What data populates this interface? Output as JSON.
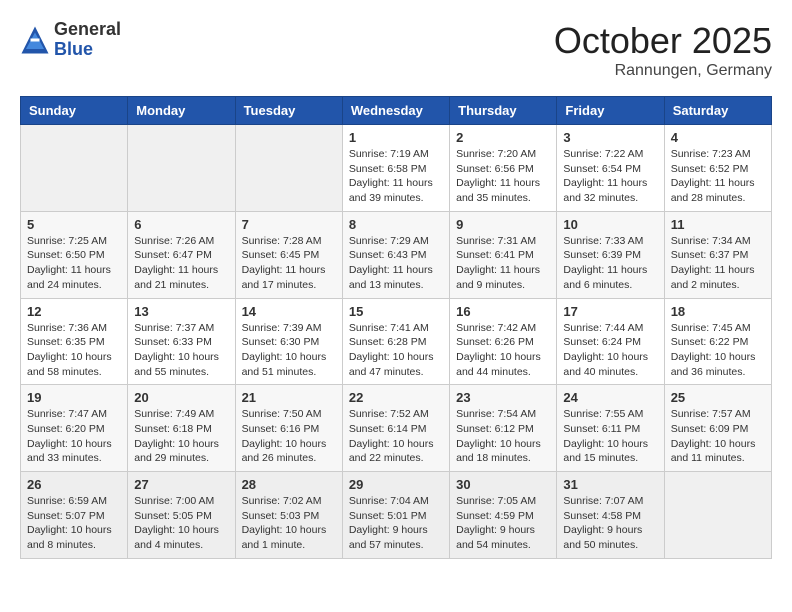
{
  "header": {
    "logo_general": "General",
    "logo_blue": "Blue",
    "month": "October 2025",
    "location": "Rannungen, Germany"
  },
  "weekdays": [
    "Sunday",
    "Monday",
    "Tuesday",
    "Wednesday",
    "Thursday",
    "Friday",
    "Saturday"
  ],
  "weeks": [
    [
      {
        "day": "",
        "info": ""
      },
      {
        "day": "",
        "info": ""
      },
      {
        "day": "",
        "info": ""
      },
      {
        "day": "1",
        "info": "Sunrise: 7:19 AM\nSunset: 6:58 PM\nDaylight: 11 hours and 39 minutes."
      },
      {
        "day": "2",
        "info": "Sunrise: 7:20 AM\nSunset: 6:56 PM\nDaylight: 11 hours and 35 minutes."
      },
      {
        "day": "3",
        "info": "Sunrise: 7:22 AM\nSunset: 6:54 PM\nDaylight: 11 hours and 32 minutes."
      },
      {
        "day": "4",
        "info": "Sunrise: 7:23 AM\nSunset: 6:52 PM\nDaylight: 11 hours and 28 minutes."
      }
    ],
    [
      {
        "day": "5",
        "info": "Sunrise: 7:25 AM\nSunset: 6:50 PM\nDaylight: 11 hours and 24 minutes."
      },
      {
        "day": "6",
        "info": "Sunrise: 7:26 AM\nSunset: 6:47 PM\nDaylight: 11 hours and 21 minutes."
      },
      {
        "day": "7",
        "info": "Sunrise: 7:28 AM\nSunset: 6:45 PM\nDaylight: 11 hours and 17 minutes."
      },
      {
        "day": "8",
        "info": "Sunrise: 7:29 AM\nSunset: 6:43 PM\nDaylight: 11 hours and 13 minutes."
      },
      {
        "day": "9",
        "info": "Sunrise: 7:31 AM\nSunset: 6:41 PM\nDaylight: 11 hours and 9 minutes."
      },
      {
        "day": "10",
        "info": "Sunrise: 7:33 AM\nSunset: 6:39 PM\nDaylight: 11 hours and 6 minutes."
      },
      {
        "day": "11",
        "info": "Sunrise: 7:34 AM\nSunset: 6:37 PM\nDaylight: 11 hours and 2 minutes."
      }
    ],
    [
      {
        "day": "12",
        "info": "Sunrise: 7:36 AM\nSunset: 6:35 PM\nDaylight: 10 hours and 58 minutes."
      },
      {
        "day": "13",
        "info": "Sunrise: 7:37 AM\nSunset: 6:33 PM\nDaylight: 10 hours and 55 minutes."
      },
      {
        "day": "14",
        "info": "Sunrise: 7:39 AM\nSunset: 6:30 PM\nDaylight: 10 hours and 51 minutes."
      },
      {
        "day": "15",
        "info": "Sunrise: 7:41 AM\nSunset: 6:28 PM\nDaylight: 10 hours and 47 minutes."
      },
      {
        "day": "16",
        "info": "Sunrise: 7:42 AM\nSunset: 6:26 PM\nDaylight: 10 hours and 44 minutes."
      },
      {
        "day": "17",
        "info": "Sunrise: 7:44 AM\nSunset: 6:24 PM\nDaylight: 10 hours and 40 minutes."
      },
      {
        "day": "18",
        "info": "Sunrise: 7:45 AM\nSunset: 6:22 PM\nDaylight: 10 hours and 36 minutes."
      }
    ],
    [
      {
        "day": "19",
        "info": "Sunrise: 7:47 AM\nSunset: 6:20 PM\nDaylight: 10 hours and 33 minutes."
      },
      {
        "day": "20",
        "info": "Sunrise: 7:49 AM\nSunset: 6:18 PM\nDaylight: 10 hours and 29 minutes."
      },
      {
        "day": "21",
        "info": "Sunrise: 7:50 AM\nSunset: 6:16 PM\nDaylight: 10 hours and 26 minutes."
      },
      {
        "day": "22",
        "info": "Sunrise: 7:52 AM\nSunset: 6:14 PM\nDaylight: 10 hours and 22 minutes."
      },
      {
        "day": "23",
        "info": "Sunrise: 7:54 AM\nSunset: 6:12 PM\nDaylight: 10 hours and 18 minutes."
      },
      {
        "day": "24",
        "info": "Sunrise: 7:55 AM\nSunset: 6:11 PM\nDaylight: 10 hours and 15 minutes."
      },
      {
        "day": "25",
        "info": "Sunrise: 7:57 AM\nSunset: 6:09 PM\nDaylight: 10 hours and 11 minutes."
      }
    ],
    [
      {
        "day": "26",
        "info": "Sunrise: 6:59 AM\nSunset: 5:07 PM\nDaylight: 10 hours and 8 minutes."
      },
      {
        "day": "27",
        "info": "Sunrise: 7:00 AM\nSunset: 5:05 PM\nDaylight: 10 hours and 4 minutes."
      },
      {
        "day": "28",
        "info": "Sunrise: 7:02 AM\nSunset: 5:03 PM\nDaylight: 10 hours and 1 minute."
      },
      {
        "day": "29",
        "info": "Sunrise: 7:04 AM\nSunset: 5:01 PM\nDaylight: 9 hours and 57 minutes."
      },
      {
        "day": "30",
        "info": "Sunrise: 7:05 AM\nSunset: 4:59 PM\nDaylight: 9 hours and 54 minutes."
      },
      {
        "day": "31",
        "info": "Sunrise: 7:07 AM\nSunset: 4:58 PM\nDaylight: 9 hours and 50 minutes."
      },
      {
        "day": "",
        "info": ""
      }
    ]
  ]
}
